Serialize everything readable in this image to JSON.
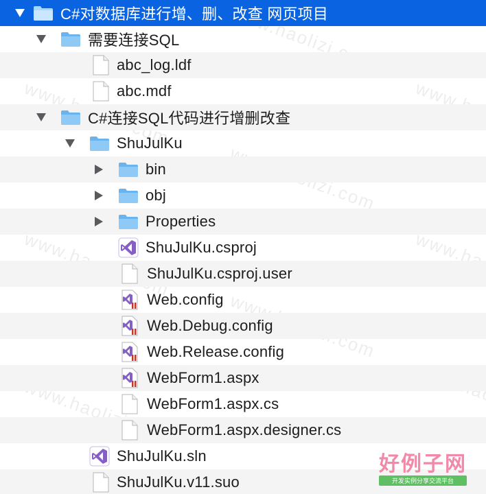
{
  "tree": {
    "root": {
      "label": "C#对数据库进行增、删、改查 网页项目",
      "icon": "folder-icon"
    },
    "items": [
      {
        "label": "需要连接SQL",
        "icon": "folder-icon"
      },
      {
        "label": "abc_log.ldf",
        "icon": "document-icon"
      },
      {
        "label": "abc.mdf",
        "icon": "document-icon"
      },
      {
        "label": "C#连接SQL代码进行增删改查",
        "icon": "folder-icon"
      },
      {
        "label": "ShuJulKu",
        "icon": "folder-icon"
      },
      {
        "label": "bin",
        "icon": "folder-icon"
      },
      {
        "label": "obj",
        "icon": "folder-icon"
      },
      {
        "label": "Properties",
        "icon": "folder-icon"
      },
      {
        "label": "ShuJulKu.csproj",
        "icon": "visual-studio-icon"
      },
      {
        "label": "ShuJulKu.csproj.user",
        "icon": "document-icon"
      },
      {
        "label": "Web.config",
        "icon": "vs-config-icon"
      },
      {
        "label": "Web.Debug.config",
        "icon": "vs-config-icon"
      },
      {
        "label": "Web.Release.config",
        "icon": "vs-config-icon"
      },
      {
        "label": "WebForm1.aspx",
        "icon": "vs-config-icon"
      },
      {
        "label": "WebForm1.aspx.cs",
        "icon": "document-icon"
      },
      {
        "label": "WebForm1.aspx.designer.cs",
        "icon": "document-icon"
      },
      {
        "label": "ShuJulKu.sln",
        "icon": "visual-studio-icon"
      },
      {
        "label": "ShuJulKu.v11.suo",
        "icon": "document-icon"
      }
    ]
  },
  "watermark": {
    "text": "www.haolizi.com"
  },
  "logo": {
    "main": "好例子网",
    "sub": "开发实例分享交流平台"
  },
  "colors": {
    "selection": "#0a63e0",
    "folder": "#7cc0f5",
    "alt_row": "#f4f4f5",
    "vs_purple": "#865fc5",
    "config_red": "#c0392b"
  }
}
